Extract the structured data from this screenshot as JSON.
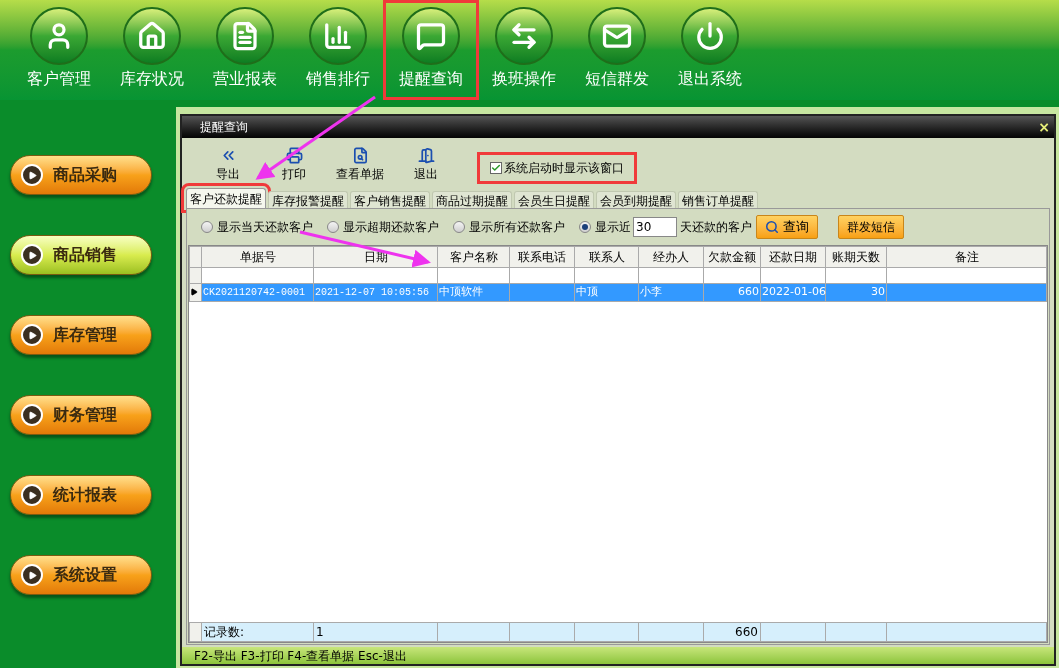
{
  "top_menu": [
    {
      "label": "客户管理",
      "kind": "customer",
      "highlighted": false
    },
    {
      "label": "库存状况",
      "kind": "home",
      "highlighted": false
    },
    {
      "label": "营业报表",
      "kind": "document",
      "highlighted": false
    },
    {
      "label": "销售排行",
      "kind": "chart",
      "highlighted": false
    },
    {
      "label": "提醒查询",
      "kind": "message",
      "highlighted": true
    },
    {
      "label": "换班操作",
      "kind": "swap",
      "highlighted": false
    },
    {
      "label": "短信群发",
      "kind": "mail",
      "highlighted": false
    },
    {
      "label": "退出系统",
      "kind": "power",
      "highlighted": false
    }
  ],
  "sidebar": [
    {
      "label": "商品采购",
      "selected": false
    },
    {
      "label": "商品销售",
      "selected": true
    },
    {
      "label": "库存管理",
      "selected": false
    },
    {
      "label": "财务管理",
      "selected": false
    },
    {
      "label": "统计报表",
      "selected": false
    },
    {
      "label": "系统设置",
      "selected": false
    }
  ],
  "window": {
    "title": "提醒查询",
    "close": "×"
  },
  "toolbar": [
    {
      "label": "导出",
      "kind": "export"
    },
    {
      "label": "打印",
      "kind": "print"
    },
    {
      "label": "查看单据",
      "kind": "view"
    },
    {
      "label": "退出",
      "kind": "exit"
    }
  ],
  "startup_checkbox": {
    "label": "系统启动时显示该窗口",
    "checked": true,
    "highlighted": true
  },
  "tabs": [
    {
      "label": "客户还款提醒",
      "selected": true,
      "highlighted": true
    },
    {
      "label": "库存报警提醒",
      "selected": false,
      "highlighted": false
    },
    {
      "label": "客户销售提醒",
      "selected": false,
      "highlighted": false
    },
    {
      "label": "商品过期提醒",
      "selected": false,
      "highlighted": false
    },
    {
      "label": "会员生日提醒",
      "selected": false,
      "highlighted": false
    },
    {
      "label": "会员到期提醒",
      "selected": false,
      "highlighted": false
    },
    {
      "label": "销售订单提醒",
      "selected": false,
      "highlighted": false
    }
  ],
  "filters": {
    "options": [
      {
        "label": "显示当天还款客户",
        "selected": false
      },
      {
        "label": "显示超期还款客户",
        "selected": false
      },
      {
        "label": "显示所有还款客户",
        "selected": false
      },
      {
        "label": "显示近",
        "selected": true
      }
    ],
    "days": "30",
    "days_suffix": "天还款的客户",
    "query_button": "查询",
    "sms_button": "群发短信"
  },
  "table": {
    "columns": [
      "单据号",
      "日期",
      "客户名称",
      "联系电话",
      "联系人",
      "经办人",
      "欠款金额",
      "还款日期",
      "账期天数",
      "备注"
    ],
    "rows": [
      {
        "selected": true,
        "cells": [
          "CK2021120742-0001",
          "2021-12-07 10:05:56",
          "中顶软件",
          "",
          "中顶",
          "小李",
          "660",
          "2022-01-06",
          "30",
          ""
        ]
      }
    ],
    "footer": {
      "label": "记录数:",
      "count": "1",
      "amount": "660"
    }
  },
  "status_bar": "F2-导出 F3-打印 F4-查看单据 Esc-退出"
}
